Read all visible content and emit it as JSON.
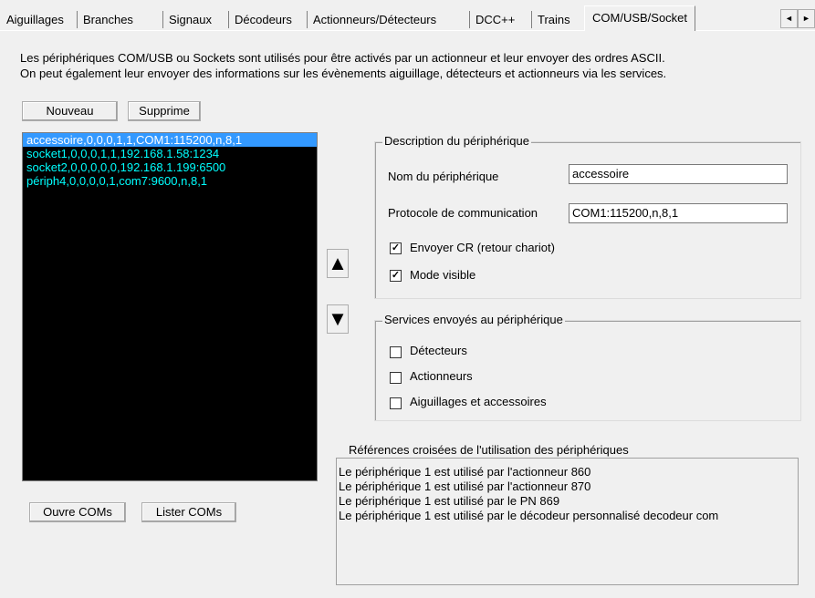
{
  "tabs": [
    {
      "label": "Aiguillages",
      "active": false
    },
    {
      "label": "Branches",
      "active": false
    },
    {
      "label": "Signaux",
      "active": false
    },
    {
      "label": "Décodeurs",
      "active": false
    },
    {
      "label": "Actionneurs/Détecteurs",
      "active": false
    },
    {
      "label": "DCC++",
      "active": false
    },
    {
      "label": "Trains",
      "active": false
    },
    {
      "label": "COM/USB/Socket",
      "active": true
    }
  ],
  "tab_scroll": {
    "left": "◄",
    "right": "►"
  },
  "description": {
    "line1": "Les périphériques COM/USB ou Sockets sont utilisés pour être activés par un actionneur et leur envoyer des ordres ASCII.",
    "line2": "On peut également leur envoyer des informations sur les évènements aiguillage, détecteurs et actionneurs via les services."
  },
  "buttons": {
    "new": "Nouveau",
    "delete": "Supprime",
    "open_coms": "Ouvre COMs",
    "list_coms": "Lister COMs"
  },
  "devices": [
    {
      "text": "accessoire,0,0,0,1,1,COM1:115200,n,8,1",
      "selected": true
    },
    {
      "text": "socket1,0,0,0,1,1,192.168.1.58:1234",
      "selected": false
    },
    {
      "text": "socket2,0,0,0,0,0,192.168.1.199:6500",
      "selected": false
    },
    {
      "text": "périph4,0,0,0,0,1,com7:9600,n,8,1",
      "selected": false
    }
  ],
  "arrows": {
    "up": "▲",
    "down": "▼"
  },
  "device_description": {
    "legend": "Description du périphérique",
    "name_label": "Nom du périphérique",
    "name_value": "accessoire",
    "protocol_label": "Protocole de communication",
    "protocol_value": "COM1:115200,n,8,1",
    "send_cr_label": "Envoyer CR (retour chariot)",
    "send_cr_checked": true,
    "visible_label": "Mode visible",
    "visible_checked": true
  },
  "services": {
    "legend": "Services envoyés au périphérique",
    "items": [
      {
        "label": "Détecteurs",
        "checked": false
      },
      {
        "label": "Actionneurs",
        "checked": false
      },
      {
        "label": "Aiguillages et accessoires",
        "checked": false
      }
    ]
  },
  "cross_references": {
    "title": "Références croisées de l'utilisation des périphériques",
    "lines": [
      "Le périphérique 1 est utilisé par l'actionneur 860",
      "Le périphérique 1 est utilisé par l'actionneur 870",
      "Le périphérique 1 est utilisé par le PN 869",
      "Le périphérique 1 est utilisé par le décodeur personnalisé decodeur com"
    ]
  },
  "colors": {
    "list_background": "#000000",
    "list_text": "#00ffff",
    "selection": "#3399ff"
  }
}
